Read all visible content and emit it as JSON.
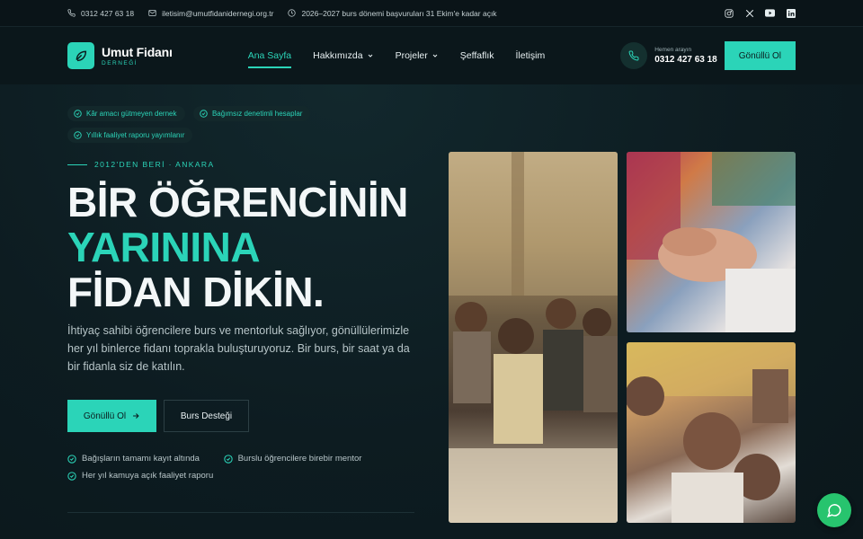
{
  "topbar": {
    "phone": "0312 427 63 18",
    "email": "iletisim@umutfidanidernegi.org.tr",
    "notice": "2026–2027 burs dönemi başvuruları 31 Ekim'e kadar açık",
    "social_icons": [
      "instagram-icon",
      "x-icon",
      "youtube-icon",
      "linkedin-icon"
    ]
  },
  "brand": {
    "name": "Umut Fidanı",
    "subtitle": "DERNEĞİ",
    "accent_color": "#2bd4b8"
  },
  "nav": {
    "items": [
      {
        "label": "Ana Sayfa",
        "active": true
      },
      {
        "label": "Hakkımızda",
        "dropdown": true
      },
      {
        "label": "Projeler",
        "dropdown": true
      },
      {
        "label": "Şeffaflık"
      },
      {
        "label": "İletişim"
      }
    ],
    "call_label": "Hemen arayın",
    "call_number": "0312 427 63 18",
    "cta": "Gönüllü Ol"
  },
  "hero": {
    "badges": [
      "Kâr amacı gütmeyen dernek",
      "Bağımsız denetimli hesaplar",
      "Yıllık faaliyet raporu yayımlanır"
    ],
    "eyebrow": "2012'DEN BERİ · ANKARA",
    "headline_1": "BİR ÖĞRENCİNİN",
    "headline_2": "YARININA",
    "headline_3": "FİDAN DİKİN.",
    "description": "İhtiyaç sahibi öğrencilere burs ve mentorluk sağlıyor, gönüllülerimizle her yıl binlerce fidanı toprakla buluşturuyoruz. Bir burs, bir saat ya da bir fidanla siz de katılın.",
    "cta_primary": "Gönüllü Ol",
    "cta_secondary": "Burs Desteği",
    "checks": [
      "Bağışların tamamı kayıt altında",
      "Burslu öğrencilere birebir mentor",
      "Her yıl kamuya açık faaliyet raporu"
    ]
  }
}
